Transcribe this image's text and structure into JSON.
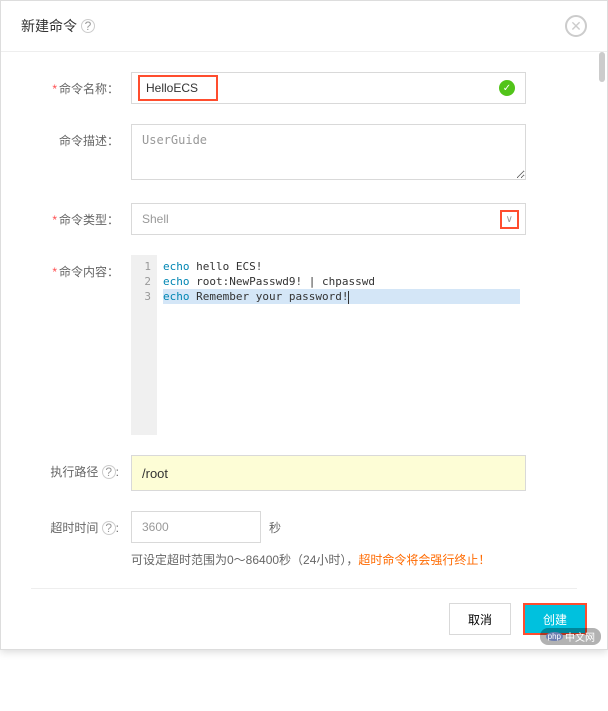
{
  "dialog": {
    "title": "新建命令",
    "close_aria": "close"
  },
  "form": {
    "name_label": "命令名称：",
    "name_value": "HelloECS",
    "desc_label": "命令描述：",
    "desc_value": "UserGuide",
    "type_label": "命令类型：",
    "type_value": "Shell",
    "content_label": "命令内容：",
    "code_lines": [
      "echo hello ECS!",
      "echo root:NewPasswd9! | chpasswd",
      "echo Remember your password!"
    ],
    "path_label": "执行路径 ",
    "path_value": "/root",
    "timeout_label": "超时时间 ",
    "timeout_value": "3600",
    "timeout_unit": "秒",
    "hint_prefix": "可设定超时范围为0～86400秒（24小时），",
    "hint_warning": "超时命令将会强行终止！"
  },
  "footer": {
    "cancel": "取消",
    "create": "创建"
  },
  "watermark": {
    "php": "php",
    "text": "中文网"
  }
}
